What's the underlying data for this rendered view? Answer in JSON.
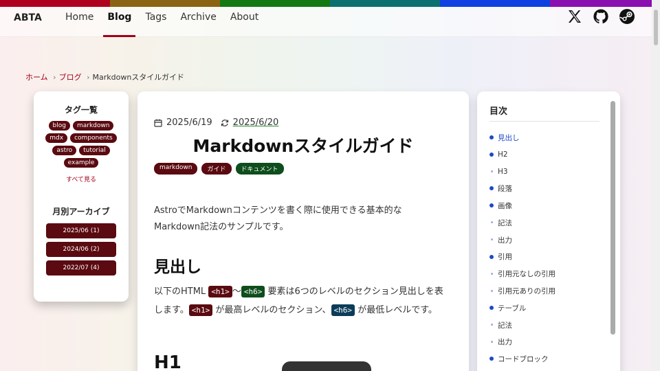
{
  "colors": {
    "accent": "#a00018",
    "tag_bg": "#5a0a10",
    "toc_active": "#1e48c8",
    "rainbow": [
      "#b00020",
      "#8a6414",
      "#137a13",
      "#0c7070",
      "#1040e0",
      "#8a10b0"
    ]
  },
  "header": {
    "logo": "ABTA",
    "nav": [
      {
        "label": "Home",
        "active": false
      },
      {
        "label": "Blog",
        "active": true
      },
      {
        "label": "Tags",
        "active": false
      },
      {
        "label": "Archive",
        "active": false
      },
      {
        "label": "About",
        "active": false
      }
    ],
    "social_icons": [
      "x-icon",
      "github-icon",
      "steam-icon"
    ]
  },
  "breadcrumb": {
    "home": "ホーム",
    "blog": "ブログ",
    "current": "Markdownスタイルガイド",
    "separator": "›"
  },
  "sidebar": {
    "tags_title": "タグ一覧",
    "tags": [
      "blog",
      "markdown",
      "mdx",
      "components",
      "astro",
      "tutorial",
      "example"
    ],
    "see_all": "すべて見る",
    "archive_title": "月別アーカイブ",
    "archives": [
      "2025/06 (1)",
      "2024/06 (2)",
      "2022/07 (4)"
    ]
  },
  "post": {
    "published": "2025/6/19",
    "updated": "2025/6/20",
    "title": "Markdownスタイルガイド",
    "tags": [
      {
        "label": "markdown",
        "color": "#5a0a10"
      },
      {
        "label": "ガイド",
        "color": "#5a0a10"
      },
      {
        "label": "ドキュメント",
        "color": "#0e4d1c"
      }
    ],
    "intro": "AstroでMarkdownコンテンツを書く際に使用できる基本的なMarkdown記法のサンプルです。",
    "heading1": "見出し",
    "para": {
      "t1": "以下のHTML ",
      "code1": "<h1>",
      "t2": "〜",
      "code2": "<h6>",
      "t3": " 要素は6つのレベルのセクション見出しを表します。",
      "code3": "<h1>",
      "t4": " が最高レベルのセクション、",
      "code4": "<h6>",
      "t5": " が最低レベルです。"
    },
    "heading2": "H1"
  },
  "toc": {
    "title": "目次",
    "items": [
      {
        "label": "見出し",
        "level": 1,
        "active": true
      },
      {
        "label": "H2",
        "level": 1,
        "active": false
      },
      {
        "label": "H3",
        "level": 2,
        "active": false
      },
      {
        "label": "段落",
        "level": 1,
        "active": false
      },
      {
        "label": "画像",
        "level": 1,
        "active": false
      },
      {
        "label": "記法",
        "level": 2,
        "active": false
      },
      {
        "label": "出力",
        "level": 2,
        "active": false
      },
      {
        "label": "引用",
        "level": 1,
        "active": false
      },
      {
        "label": "引用元なしの引用",
        "level": 2,
        "active": false
      },
      {
        "label": "引用元ありの引用",
        "level": 2,
        "active": false
      },
      {
        "label": "テーブル",
        "level": 1,
        "active": false
      },
      {
        "label": "記法",
        "level": 2,
        "active": false
      },
      {
        "label": "出力",
        "level": 2,
        "active": false
      },
      {
        "label": "コードブロック",
        "level": 1,
        "active": false
      }
    ]
  }
}
